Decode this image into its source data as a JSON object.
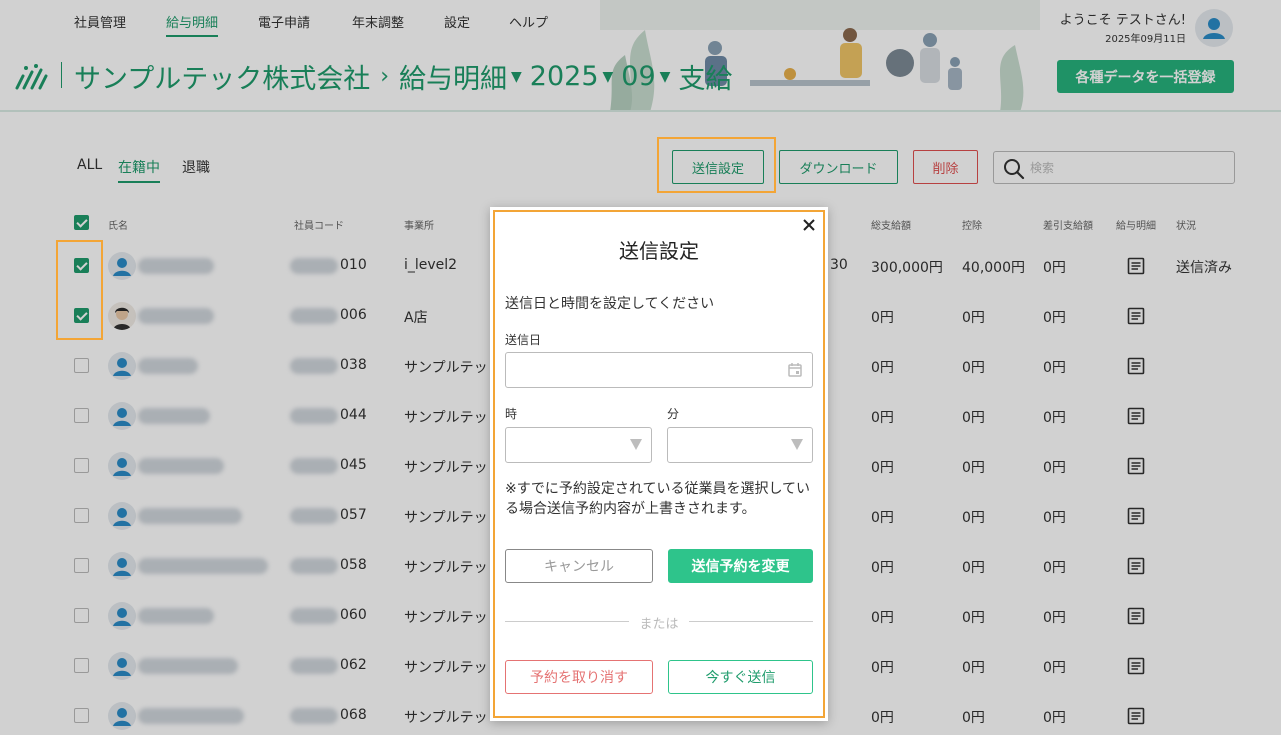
{
  "nav": {
    "items": [
      {
        "label": "社員管理",
        "active": false
      },
      {
        "label": "給与明細",
        "active": true
      },
      {
        "label": "電子申請",
        "active": false
      },
      {
        "label": "年末調整",
        "active": false
      },
      {
        "label": "設定",
        "active": false
      },
      {
        "label": "ヘルプ",
        "active": false
      }
    ]
  },
  "user": {
    "welcome": "ようこそ テストさん!",
    "date": "2025年09月11日"
  },
  "breadcrumb": {
    "company": "サンプルテック株式会社",
    "separator": "›",
    "section": "給与明細",
    "year": "2025",
    "month": "09",
    "type": "支給"
  },
  "header": {
    "bulk_button": "各種データを一括登録"
  },
  "filters": [
    {
      "label": "ALL",
      "active": false
    },
    {
      "label": "在籍中",
      "active": true
    },
    {
      "label": "退職",
      "active": false
    }
  ],
  "toolbar": {
    "send_settings": "送信設定",
    "download": "ダウンロード",
    "delete": "削除",
    "search_placeholder": "検索"
  },
  "table": {
    "headers": [
      "氏名",
      "社員コード",
      "事業所",
      "総支給額",
      "控除",
      "差引支給額",
      "給与明細",
      "状況"
    ],
    "rows": [
      {
        "checked": true,
        "code": "010",
        "office": "i_level2",
        "partial": "30",
        "total": "300,000円",
        "deduction": "40,000円",
        "net": "0円",
        "status": "送信済み"
      },
      {
        "checked": true,
        "code": "006",
        "office": "A店",
        "partial": "",
        "total": "0円",
        "deduction": "0円",
        "net": "0円",
        "status": ""
      },
      {
        "checked": false,
        "code": "038",
        "office": "サンプルテッ",
        "partial": "",
        "total": "0円",
        "deduction": "0円",
        "net": "0円",
        "status": ""
      },
      {
        "checked": false,
        "code": "044",
        "office": "サンプルテッ",
        "partial": "",
        "total": "0円",
        "deduction": "0円",
        "net": "0円",
        "status": ""
      },
      {
        "checked": false,
        "code": "045",
        "office": "サンプルテッ",
        "partial": "",
        "total": "0円",
        "deduction": "0円",
        "net": "0円",
        "status": ""
      },
      {
        "checked": false,
        "code": "057",
        "office": "サンプルテッ",
        "partial": "",
        "total": "0円",
        "deduction": "0円",
        "net": "0円",
        "status": ""
      },
      {
        "checked": false,
        "code": "058",
        "office": "サンプルテッ",
        "partial": "",
        "total": "0円",
        "deduction": "0円",
        "net": "0円",
        "status": ""
      },
      {
        "checked": false,
        "code": "060",
        "office": "サンプルテッ",
        "partial": "",
        "total": "0円",
        "deduction": "0円",
        "net": "0円",
        "status": ""
      },
      {
        "checked": false,
        "code": "062",
        "office": "サンプルテッ",
        "partial": "",
        "total": "0円",
        "deduction": "0円",
        "net": "0円",
        "status": ""
      },
      {
        "checked": false,
        "code": "068",
        "office": "サンプルテッ",
        "partial": "",
        "total": "0円",
        "deduction": "0円",
        "net": "0円",
        "status": ""
      }
    ]
  },
  "modal": {
    "title": "送信設定",
    "lead": "送信日と時間を設定してください",
    "date_label": "送信日",
    "date_value": "",
    "hour_label": "時",
    "hour_value": "",
    "minute_label": "分",
    "minute_value": "",
    "note": "※すでに予約設定されている従業員を選択している場合送信予約内容が上書きされます。",
    "cancel": "キャンセル",
    "change": "送信予約を変更",
    "or": "または",
    "revoke": "予約を取り消す",
    "send_now": "今すぐ送信"
  },
  "colors": {
    "accent": "#1f9c6c",
    "primary_button": "#27b37d",
    "danger": "#e05050",
    "highlight": "#f3a536"
  }
}
